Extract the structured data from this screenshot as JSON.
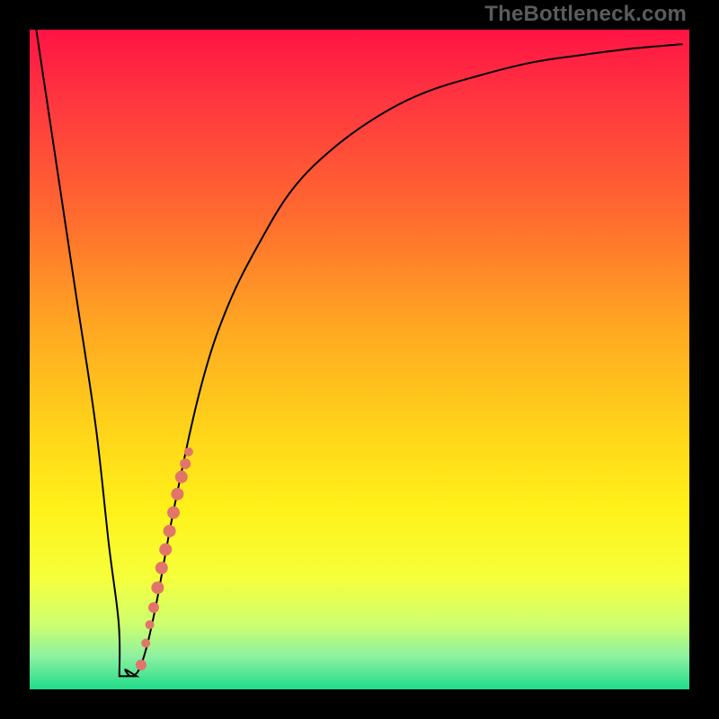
{
  "watermark": "TheBottleneck.com",
  "colors": {
    "frame": "#000000",
    "curve": "#000000",
    "dot": "#e2756a",
    "grad_stops": [
      {
        "pos": 0.0,
        "c": "#ff1444"
      },
      {
        "pos": 0.12,
        "c": "#ff3a3f"
      },
      {
        "pos": 0.28,
        "c": "#ff6a2f"
      },
      {
        "pos": 0.45,
        "c": "#ffa722"
      },
      {
        "pos": 0.6,
        "c": "#ffd21a"
      },
      {
        "pos": 0.73,
        "c": "#fff21a"
      },
      {
        "pos": 0.83,
        "c": "#f6ff3a"
      },
      {
        "pos": 0.9,
        "c": "#cfff6e"
      },
      {
        "pos": 0.95,
        "c": "#8df1a0"
      },
      {
        "pos": 1.0,
        "c": "#1fdc8a"
      }
    ]
  },
  "chart_data": {
    "type": "line",
    "title": "",
    "xlabel": "",
    "ylabel": "",
    "xlim": [
      0,
      100
    ],
    "ylim": [
      0,
      100
    ],
    "series": [
      {
        "name": "bottleneck-curve",
        "x": [
          1,
          4,
          7,
          10,
          12,
          13.5,
          14.5,
          15.5,
          17,
          19,
          22,
          26,
          30,
          35,
          40,
          46,
          53,
          60,
          68,
          76,
          84,
          92,
          99
        ],
        "y": [
          100,
          80,
          60,
          40,
          22,
          10,
          3,
          2,
          4,
          12,
          28,
          46,
          58,
          68,
          76,
          82,
          87,
          90.5,
          93,
          95,
          96.2,
          97.2,
          97.8
        ]
      }
    ],
    "flat_bottom": {
      "x_start": 13.6,
      "x_end": 16.2,
      "y": 2
    },
    "dots": {
      "name": "highlight-dots",
      "points": [
        {
          "x": 16.9,
          "y": 3.7,
          "r": 6
        },
        {
          "x": 17.6,
          "y": 7.0,
          "r": 5
        },
        {
          "x": 18.2,
          "y": 9.8,
          "r": 5
        },
        {
          "x": 18.8,
          "y": 12.4,
          "r": 6
        },
        {
          "x": 19.4,
          "y": 15.4,
          "r": 7
        },
        {
          "x": 20.0,
          "y": 18.4,
          "r": 7
        },
        {
          "x": 20.6,
          "y": 21.2,
          "r": 7
        },
        {
          "x": 21.2,
          "y": 24.0,
          "r": 7
        },
        {
          "x": 21.8,
          "y": 26.8,
          "r": 7
        },
        {
          "x": 22.4,
          "y": 29.6,
          "r": 7
        },
        {
          "x": 23.0,
          "y": 32.2,
          "r": 7
        },
        {
          "x": 23.6,
          "y": 34.2,
          "r": 6
        },
        {
          "x": 24.1,
          "y": 36.0,
          "r": 5
        }
      ]
    }
  }
}
